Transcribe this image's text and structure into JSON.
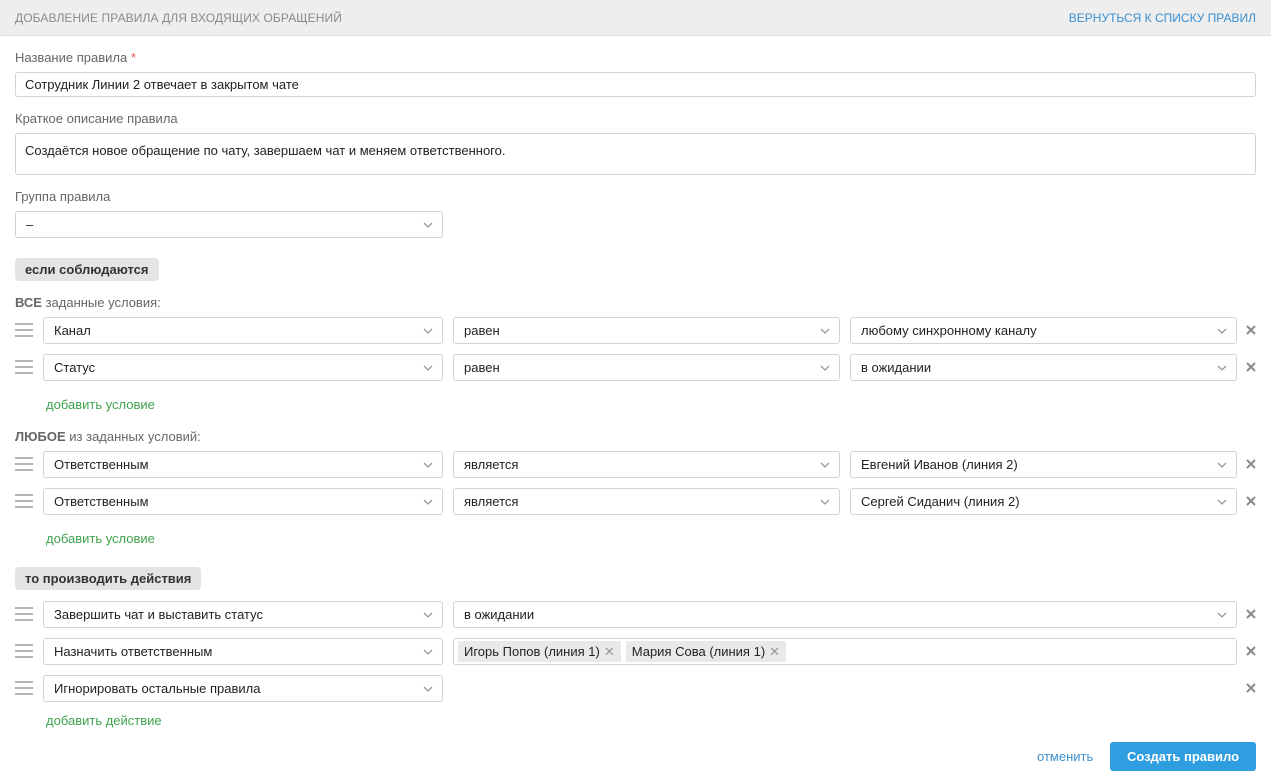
{
  "header": {
    "title": "Добавление правила для входящих обращений",
    "back_link": "Вернуться к списку правил"
  },
  "form": {
    "name_label": "Название правила",
    "name_required_mark": "*",
    "name_value": "Сотрудник Линии 2 отвечает в закрытом чате",
    "desc_label": "Краткое описание правила",
    "desc_value": "Создаётся новое обращение по чату, завершаем чат и меняем ответственного.",
    "group_label": "Группа правила",
    "group_value": "–"
  },
  "conditions": {
    "section_pill": "если соблюдаются",
    "all": {
      "label_strong": "ВСЕ",
      "label_rest": " заданные условия:",
      "rows": [
        {
          "field": "Канал",
          "operator": "равен",
          "value": "любому синхронному каналу"
        },
        {
          "field": "Статус",
          "operator": "равен",
          "value": "в ожидании"
        }
      ],
      "add_label": "добавить условие"
    },
    "any": {
      "label_strong": "ЛЮБОЕ",
      "label_rest": " из заданных условий:",
      "rows": [
        {
          "field": "Ответственным",
          "operator": "является",
          "value": "Евгений Иванов (линия 2)"
        },
        {
          "field": "Ответственным",
          "operator": "является",
          "value": "Сергей Сиданич (линия 2)"
        }
      ],
      "add_label": "добавить условие"
    }
  },
  "actions": {
    "section_pill": "то производить действия",
    "rows": [
      {
        "action": "Завершить чат и выставить статус",
        "value": "в ожидании"
      },
      {
        "action": "Назначить ответственным",
        "tags": [
          "Игорь Попов (линия 1)",
          "Мария Сова (линия 1)"
        ]
      },
      {
        "action": "Игнорировать остальные правила"
      }
    ],
    "add_label": "добавить действие"
  },
  "footer": {
    "cancel_label": "отменить",
    "submit_label": "Создать правило"
  },
  "colors": {
    "link_blue": "#3b8fd0",
    "add_green": "#3fa34d",
    "submit_blue": "#2e9ee0",
    "required_red": "#e05a4f"
  },
  "icons": {
    "drag": "drag-handle-icon",
    "remove": "close-icon",
    "dropdown": "chevron-down-icon"
  }
}
